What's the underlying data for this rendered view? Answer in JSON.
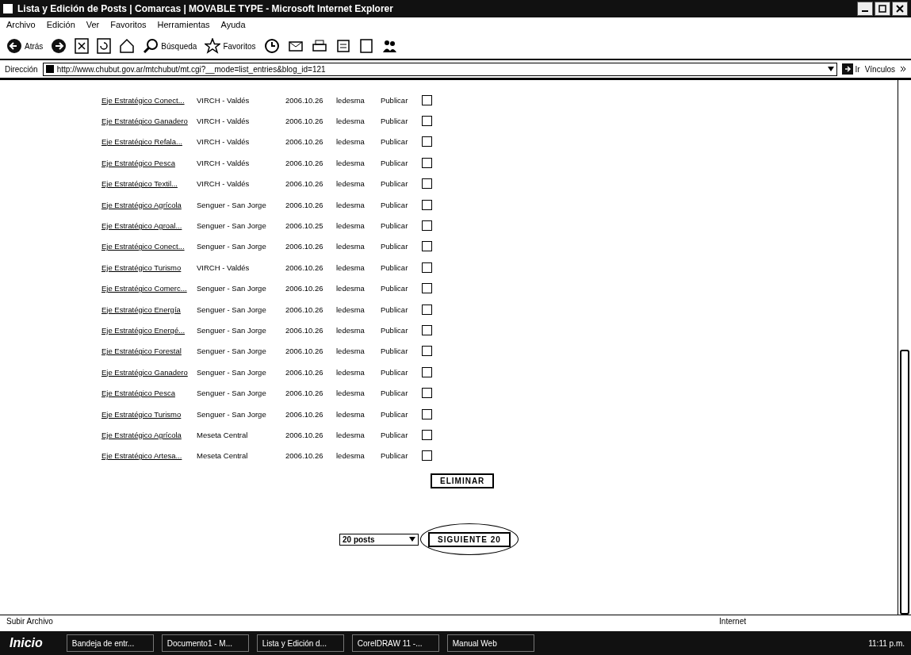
{
  "window": {
    "title": "Lista y Edición de Posts | Comarcas | MOVABLE TYPE - Microsoft Internet Explorer"
  },
  "menu": [
    "Archivo",
    "Edición",
    "Ver",
    "Favoritos",
    "Herramientas",
    "Ayuda"
  ],
  "toolbar": {
    "back": "Atrás",
    "search": "Búsqueda",
    "favorites": "Favoritos"
  },
  "address": {
    "label": "Dirección",
    "value": "http://www.chubut.gov.ar/mtchubut/mt.cgi?__mode=list_entries&blog_id=121",
    "go": "Ir",
    "links": "Vínculos"
  },
  "rows": [
    {
      "title": "Eje Estratégico Conect...",
      "region": "VIRCH - Valdés",
      "date": "2006.10.26",
      "author": "ledesma",
      "status": "Publicar",
      "checked": false
    },
    {
      "title": "Eje Estratégico Ganadero",
      "region": "VIRCH - Valdés",
      "date": "2006.10.26",
      "author": "ledesma",
      "status": "Publicar",
      "checked": false
    },
    {
      "title": "Eje Estratégico Refala...",
      "region": "VIRCH - Valdés",
      "date": "2006.10.26",
      "author": "ledesma",
      "status": "Publicar",
      "checked": false
    },
    {
      "title": "Eje Estratégico Pesca",
      "region": "VIRCH - Valdés",
      "date": "2006.10.26",
      "author": "ledesma",
      "status": "Publicar",
      "checked": false
    },
    {
      "title": "Eje Estratégico Textil...",
      "region": "VIRCH - Valdés",
      "date": "2006.10.26",
      "author": "ledesma",
      "status": "Publicar",
      "checked": false
    },
    {
      "title": "Eje Estratégico Agrícola",
      "region": "Senguer - San Jorge",
      "date": "2006.10.26",
      "author": "ledesma",
      "status": "Publicar",
      "checked": false
    },
    {
      "title": "Eje Estratégico Agroal...",
      "region": "Senguer - San Jorge",
      "date": "2006.10.25",
      "author": "ledesma",
      "status": "Publicar",
      "checked": false
    },
    {
      "title": "Eje Estratégico Conect...",
      "region": "Senguer - San Jorge",
      "date": "2006.10.26",
      "author": "ledesma",
      "status": "Publicar",
      "checked": false
    },
    {
      "title": "Eje Estratégico Turismo",
      "region": "VIRCH - Valdés",
      "date": "2006.10.26",
      "author": "ledesma",
      "status": "Publicar",
      "checked": false
    },
    {
      "title": "Eje Estratégico Comerc...",
      "region": "Senguer - San Jorge",
      "date": "2006.10.26",
      "author": "ledesma",
      "status": "Publicar",
      "checked": false
    },
    {
      "title": "Eje Estratégico Energía",
      "region": "Senguer - San Jorge",
      "date": "2006.10.26",
      "author": "ledesma",
      "status": "Publicar",
      "checked": false
    },
    {
      "title": "Eje Estratégico Energé...",
      "region": "Senguer - San Jorge",
      "date": "2006.10.26",
      "author": "ledesma",
      "status": "Publicar",
      "checked": false
    },
    {
      "title": "Eje Estratégico Forestal",
      "region": "Senguer - San Jorge",
      "date": "2006.10.26",
      "author": "ledesma",
      "status": "Publicar",
      "checked": false
    },
    {
      "title": "Eje Estratégico Ganadero",
      "region": "Senguer - San Jorge",
      "date": "2006.10.26",
      "author": "ledesma",
      "status": "Publicar",
      "checked": false
    },
    {
      "title": "Eje Estratégico Pesca",
      "region": "Senguer - San Jorge",
      "date": "2006.10.26",
      "author": "ledesma",
      "status": "Publicar",
      "checked": false
    },
    {
      "title": "Eje Estratégico Turismo",
      "region": "Senguer - San Jorge",
      "date": "2006.10.26",
      "author": "ledesma",
      "status": "Publicar",
      "checked": false
    },
    {
      "title": "Eje Estratégico Agrícola",
      "region": "Meseta Central",
      "date": "2006.10.26",
      "author": "ledesma",
      "status": "Publicar",
      "checked": false
    },
    {
      "title": "Eje Estratégico Artesa...",
      "region": "Meseta Central",
      "date": "2006.10.26",
      "author": "ledesma",
      "status": "Publicar",
      "checked": false
    }
  ],
  "delete_button": "ELIMINAR",
  "pager": {
    "select": "20 posts",
    "next": "SIGUIENTE 20"
  },
  "status_bar": {
    "text": "Subir Archivo",
    "zone": "Internet"
  },
  "taskbar": {
    "start": "Inicio",
    "tasks": [
      "Bandeja de entr...",
      "Documento1 - M...",
      "Lista y Edición d...",
      "CorelDRAW 11 -...",
      "Manual Web"
    ],
    "clock": "11:11 p.m."
  }
}
